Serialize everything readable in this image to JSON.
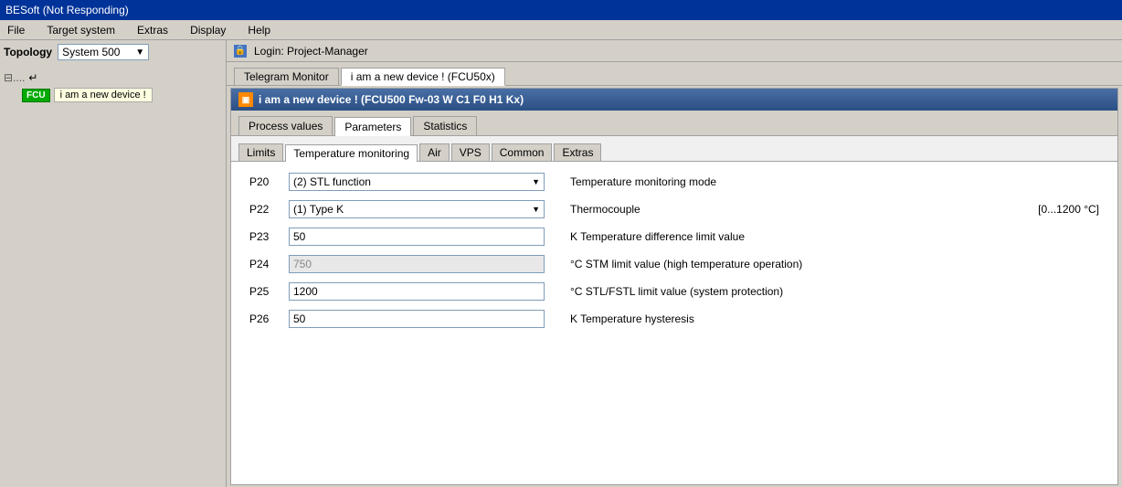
{
  "titleBar": {
    "label": "BESoft (Not Responding)"
  },
  "menuBar": {
    "items": [
      "File",
      "Target system",
      "Extras",
      "Display",
      "Help"
    ]
  },
  "sidebar": {
    "topologyLabel": "Topology",
    "systemDropdown": "System 500",
    "treeRoot": "⊟....  ↵",
    "fcuLabel": "FCU",
    "deviceLabel": "i am a new device !"
  },
  "loginBar": {
    "icon": "🔒",
    "text": "Login: Project-Manager"
  },
  "telegramMonitor": {
    "label": "Telegram Monitor",
    "tab": "i am a new device ! (FCU50x)"
  },
  "devicePanel": {
    "iconText": "▣",
    "title": "i am a new device ! (FCU500 Fw-03 W C1 F0 H1 Kx)"
  },
  "mainTabs": {
    "tabs": [
      "Process values",
      "Parameters",
      "Statistics"
    ],
    "activeTab": 1
  },
  "subTabs": {
    "tabs": [
      "Limits",
      "Temperature monitoring",
      "Air",
      "VPS",
      "Common",
      "Extras"
    ],
    "activeTab": 1
  },
  "parameters": [
    {
      "id": "P20",
      "type": "dropdown",
      "value": "(2) STL function",
      "description": "Temperature monitoring mode",
      "unit": ""
    },
    {
      "id": "P22",
      "type": "dropdown",
      "value": "(1) Type K",
      "description": "Thermocouple",
      "unit": "[0...1200 °C]"
    },
    {
      "id": "P23",
      "type": "input",
      "value": "50",
      "disabled": false,
      "description": "K Temperature difference limit value",
      "unit": ""
    },
    {
      "id": "P24",
      "type": "input",
      "value": "750",
      "disabled": true,
      "description": "°C STM limit value (high temperature operation)",
      "unit": ""
    },
    {
      "id": "P25",
      "type": "input",
      "value": "1200",
      "disabled": false,
      "description": "°C STL/FSTL limit value (system protection)",
      "unit": ""
    },
    {
      "id": "P26",
      "type": "input",
      "value": "50",
      "disabled": false,
      "description": "K Temperature hysteresis",
      "unit": ""
    }
  ]
}
